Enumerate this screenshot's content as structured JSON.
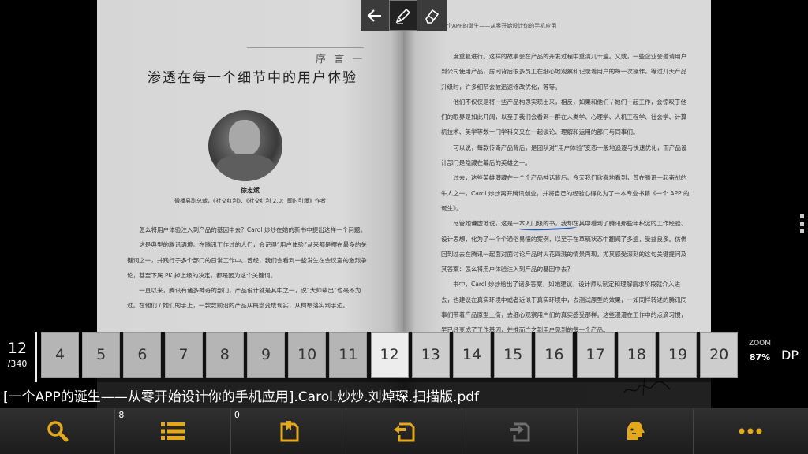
{
  "book": {
    "left_page": {
      "preface_label": "序 言 一",
      "title": "渗透在每一个细节中的用户体验",
      "author_name": "徐志斌",
      "author_title": "微播易副总裁，《社交红利》、《社交红利 2.0：即时引爆》作者",
      "paragraphs": [
        "怎么将用户体验注入到产品的基因中去？Carol 炒炒在她的新书中提出这样一个问题。",
        "这是典型的腾讯语境。在腾讯工作过的人们，会记得“用户体验”从来都是摆在最多的关键词之一，并践行于多个部门的日常工作中。曾经，我们会看到一些发生在会议室的激烈争论，甚至下属 PK 掉上级的决定，都是因为这个关键词。",
        "一直以来，腾讯有诸多神奇的部门，产品设计就是其中之一，说“大师辈出”也毫不为过。在他们 / 她们的手上，一款款前沿的产品从概念变成现实，从构想落实到手边。"
      ]
    },
    "right_page": {
      "running_head": "一个APP的诞生——从零开始设计你的手机应用",
      "paragraphs": [
        "度重复进行。这样的故事会在产品的开发过程中重演几十遍。又或，一些企业会邀请用户到公司使用产品，房间背后很多员工在细心地观察和记录着用户的每一次操作，等过几天产品升级时，许多细节会被迅速修改优化，等等。",
        "他们不仅仅是将一些产品构思实现出来，相反，如果和他们 / 她们一起工作，会惊叹于他们的眼界是如此开阔，以至于我们会看到一群在人类学、心理学、人机工程学、社会学、计算机技术、美学等数十门学科交叉在一起谈论、理解和运用的部门与同事们。",
        "可以说，每款传奇产品背后，是团队对“用户体验”变态一般地追逐与快速优化，而产品设计部门是隐藏在幕后的英雄之一。",
        "过去，这些英雄潜藏在一个个产品神话背后。今天我们欣喜地看到，曾在腾讯一起奋战的牛人之一，Carol 炒炒离开腾讯创业，并将自己的经验心得化为了一本专业书籍《一个 APP 的诞生》。",
        "尽管她谦虚地说，这是一本入门级的书，我却在其中看到了腾讯那些年积淀的工作经验、设计思想，化为了一个个通俗易懂的案例，以至于在草稿状态中翻阅了多遍，受益良多。仿佛回到过去在腾讯一起面对面讨论产品时火花四溅的情景再现。尤其感受深刻的这句关键提问及其答案：怎么将用户体验注入到产品的基因中去？",
        "书中，Carol 炒炒给出了诸多答案，如她建议，设计师从制定和理解需求阶段就介入进去，也建议在真实环境中或者近似于真实环境中，去测试原型的效果，一如同样转述的腾讯同事们带着产品原型上街，去细心观察用户们的真实感受那样。这些漫漫在工作中的点滴习惯，早已经变成了工作基因，并推而广之到用户见到的每一个产品。"
      ]
    }
  },
  "top_toolbar": {
    "tools": [
      {
        "id": "back",
        "icon": "arrow-left-icon"
      },
      {
        "id": "pen",
        "icon": "pen-icon",
        "active": true
      },
      {
        "id": "eraser",
        "icon": "eraser-icon"
      }
    ]
  },
  "thumbnail_strip": {
    "current_page": "12",
    "total_pages": "/340",
    "thumbnails": [
      "4",
      "5",
      "6",
      "7",
      "8",
      "9",
      "10",
      "11",
      "12",
      "13",
      "14",
      "15",
      "16",
      "17",
      "18",
      "19",
      "20"
    ],
    "current_thumbnail": "12",
    "zoom_label": "ZOOM",
    "zoom_value": "87%",
    "mode_label": "DP"
  },
  "file": {
    "name": "[一个APP的诞生——从零开始设计你的手机应用].Carol.炒炒.刘焯琛.扫描版.pdf"
  },
  "bottom_toolbar": {
    "buttons": [
      {
        "id": "search",
        "icon": "search-icon",
        "count": ""
      },
      {
        "id": "toc",
        "icon": "list-icon",
        "count": "8"
      },
      {
        "id": "bookmarks",
        "icon": "bookmark-icon",
        "count": "0"
      },
      {
        "id": "go-back",
        "icon": "go-back-page-icon",
        "count": ""
      },
      {
        "id": "go-forward",
        "icon": "go-forward-page-icon",
        "count": ""
      },
      {
        "id": "tts",
        "icon": "speak-icon",
        "count": ""
      },
      {
        "id": "more",
        "icon": "more-icon",
        "count": ""
      }
    ]
  },
  "colors": {
    "accent": "#e3a81c",
    "annotation_ink": "#2a5aa8"
  }
}
